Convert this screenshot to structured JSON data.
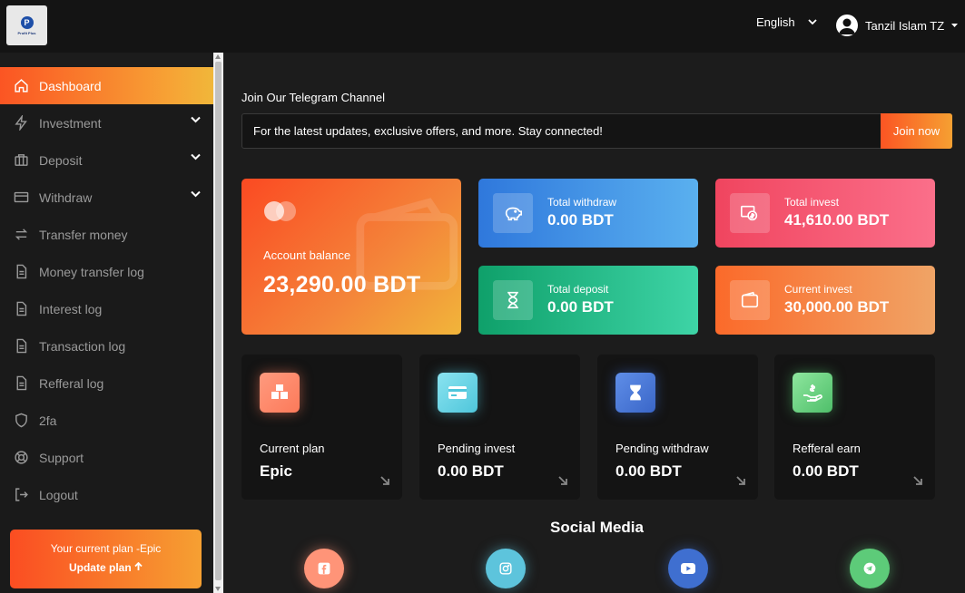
{
  "header": {
    "logo_text": "Profit Plus",
    "language": "English",
    "user_name": "Tanzil Islam TZ"
  },
  "sidebar": {
    "items": [
      {
        "label": "Dashboard",
        "icon": "home-icon",
        "active": true
      },
      {
        "label": "Investment",
        "icon": "bolt-icon",
        "has_submenu": true
      },
      {
        "label": "Deposit",
        "icon": "briefcase-icon",
        "has_submenu": true
      },
      {
        "label": "Withdraw",
        "icon": "card-icon",
        "has_submenu": true
      },
      {
        "label": "Transfer money",
        "icon": "transfer-icon"
      },
      {
        "label": "Money transfer log",
        "icon": "document-icon"
      },
      {
        "label": "Interest log",
        "icon": "document-icon"
      },
      {
        "label": "Transaction log",
        "icon": "document-icon"
      },
      {
        "label": "Refferal log",
        "icon": "document-icon"
      },
      {
        "label": "2fa",
        "icon": "shield-icon"
      },
      {
        "label": "Support",
        "icon": "lifebuoy-icon"
      },
      {
        "label": "Logout",
        "icon": "logout-icon"
      }
    ],
    "plan_text": "Your current plan -Epic",
    "update_plan_label": "Update plan"
  },
  "telegram": {
    "title": "Join Our Telegram Channel",
    "message": "For the latest updates, exclusive offers, and more. Stay connected!",
    "join_label": "Join now"
  },
  "balance": {
    "label": "Account balance",
    "value": "23,290.00 BDT"
  },
  "stats": [
    {
      "label": "Total withdraw",
      "value": "0.00 BDT",
      "icon": "piggy-bank-icon"
    },
    {
      "label": "Total invest",
      "value": "41,610.00 BDT",
      "icon": "money-icon"
    },
    {
      "label": "Total deposit",
      "value": "0.00 BDT",
      "icon": "hourglass-icon"
    },
    {
      "label": "Current invest",
      "value": "30,000.00 BDT",
      "icon": "wallet-icon"
    }
  ],
  "mini_cards": [
    {
      "label": "Current plan",
      "value": "Epic",
      "icon": "boxes-icon"
    },
    {
      "label": "Pending invest",
      "value": "0.00 BDT",
      "icon": "card-icon"
    },
    {
      "label": "Pending withdraw",
      "value": "0.00 BDT",
      "icon": "hourglass-icon"
    },
    {
      "label": "Refferal earn",
      "value": "0.00 BDT",
      "icon": "hand-money-icon"
    }
  ],
  "social": {
    "title": "Social Media",
    "links": [
      "facebook-icon",
      "instagram-icon",
      "youtube-icon",
      "telegram-icon"
    ]
  },
  "colors": {
    "accent_start": "#fb5523",
    "accent_end": "#f6a032",
    "background": "#1c1c1c",
    "card_bg": "#141414"
  }
}
